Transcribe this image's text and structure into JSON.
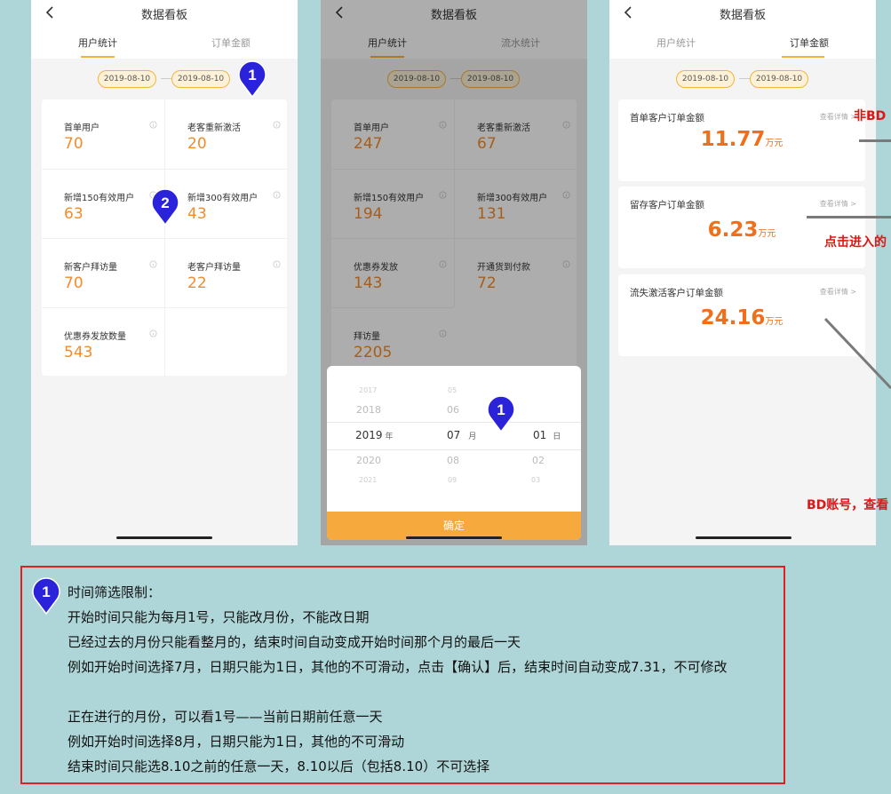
{
  "screen1": {
    "title": "数据看板",
    "tabs": [
      "用户统计",
      "订单金额"
    ],
    "start_date": "2019-08-10",
    "end_date": "2019-08-10",
    "metrics": [
      {
        "label": "首单用户",
        "value": "70"
      },
      {
        "label": "老客重新激活",
        "value": "20"
      },
      {
        "label": "新增150有效用户",
        "value": "63"
      },
      {
        "label": "新增300有效用户",
        "value": "43"
      },
      {
        "label": "新客户拜访量",
        "value": "70"
      },
      {
        "label": "老客户拜访量",
        "value": "22"
      },
      {
        "label": "优惠券发放数量",
        "value": "543"
      }
    ]
  },
  "screen2": {
    "title": "数据看板",
    "tabs": [
      "用户统计",
      "流水统计"
    ],
    "start_date": "2019-08-10",
    "end_date": "2019-08-10",
    "metrics": [
      {
        "label": "首单用户",
        "value": "247"
      },
      {
        "label": "老客重新激活",
        "value": "67"
      },
      {
        "label": "新增150有效用户",
        "value": "194"
      },
      {
        "label": "新增300有效用户",
        "value": "131"
      },
      {
        "label": "优惠券发放",
        "value": "143"
      },
      {
        "label": "开通货到付款",
        "value": "72"
      },
      {
        "label": "拜访量",
        "value": "2205"
      }
    ],
    "picker": {
      "years": [
        "2017",
        "2018",
        "2019",
        "2020",
        "2021"
      ],
      "months": [
        "05",
        "06",
        "07",
        "08",
        "09"
      ],
      "days": [
        "01",
        "02",
        "03"
      ],
      "year_unit": "年",
      "month_unit": "月",
      "day_unit": "日",
      "confirm": "确定"
    }
  },
  "screen3": {
    "title": "数据看板",
    "tabs": [
      "用户统计",
      "订单金额"
    ],
    "start_date": "2019-08-10",
    "end_date": "2019-08-10",
    "cards": [
      {
        "title": "首单客户订单金额",
        "link": "查看详情 >",
        "value": "11.77",
        "unit": "万元"
      },
      {
        "title": "留存客户订单金额",
        "link": "查看详情 >",
        "value": "6.23",
        "unit": "万元"
      },
      {
        "title": "流失激活客户订单金额",
        "link": "查看详情 >",
        "value": "24.16",
        "unit": "万元"
      }
    ]
  },
  "annotations": {
    "a1": "非BD",
    "a2": "点击进入的",
    "a3": "BD账号，查看"
  },
  "markers": [
    "1",
    "2",
    "1",
    "1"
  ],
  "notes": {
    "marker": "1",
    "lines": [
      "时间筛选限制：",
      "开始时间只能为每月1号，只能改月份，不能改日期",
      "已经过去的月份只能看整月的，结束时间自动变成开始时间那个月的最后一天",
      "例如开始时间选择7月，日期只能为1日，其他的不可滑动，点击【确认】后，结束时间自动变成7.31，不可修改",
      "正在进行的月份，可以看1号——当前日期前任意一天",
      "例如开始时间选择8月，日期只能为1日，其他的不可滑动",
      "结束时间只能选8.10之前的任意一天，8.10以后（包括8.10）不可选择"
    ]
  },
  "colors": {
    "accent": "#f6b33a",
    "value_orange": "#f58b2a",
    "marker_blue": "#2a23d9",
    "annotation_red": "#e01515"
  }
}
